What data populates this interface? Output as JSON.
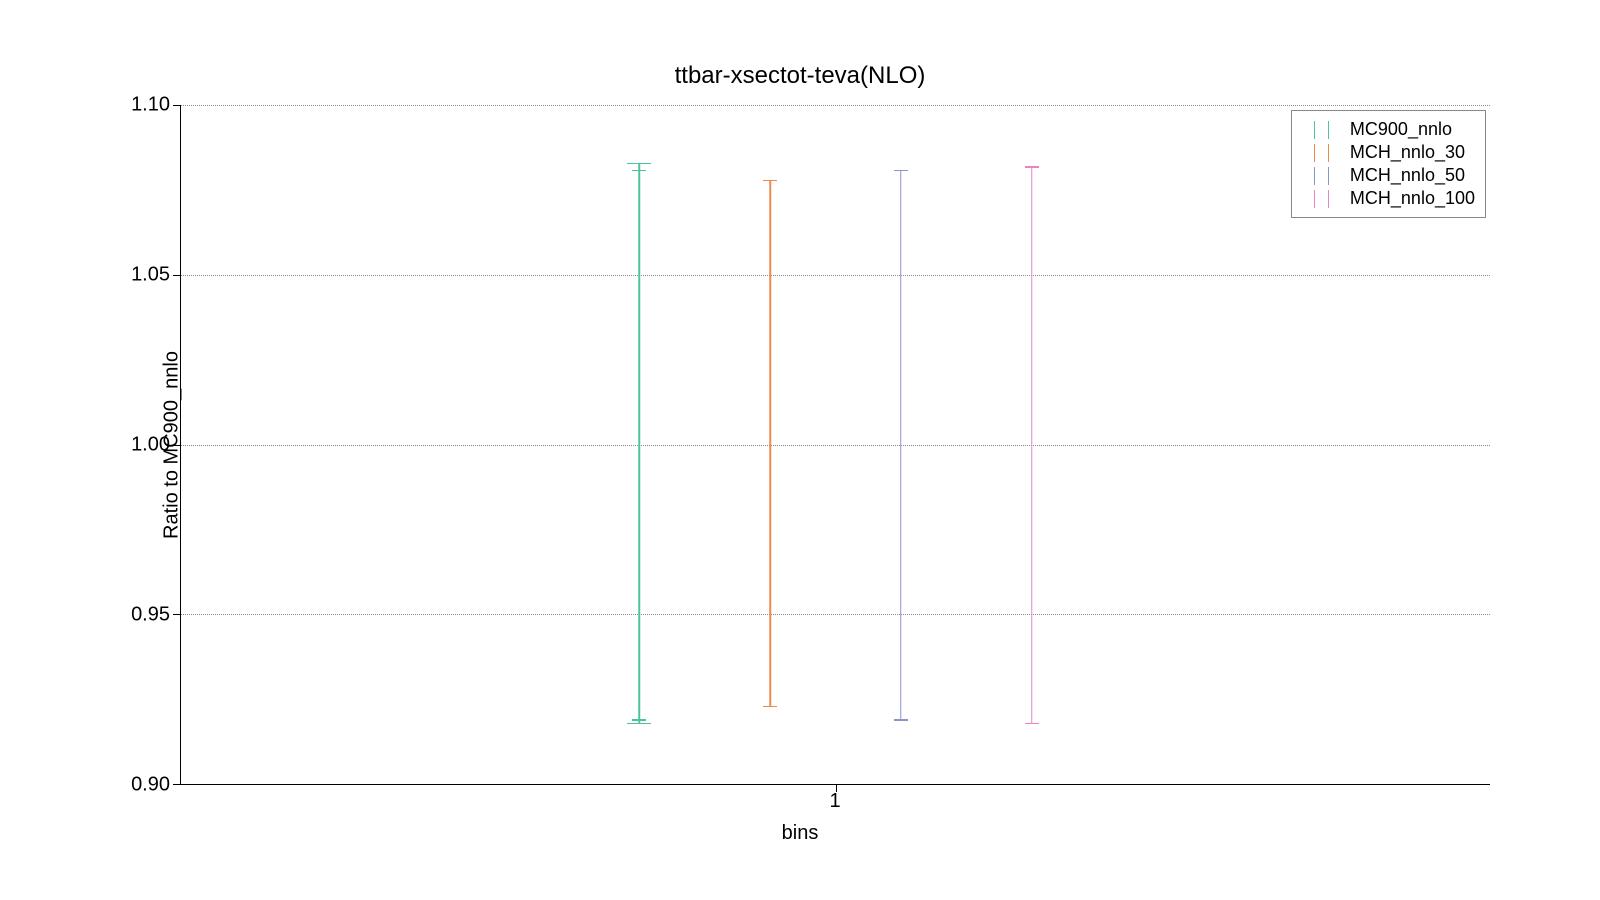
{
  "chart_data": {
    "type": "errorbar",
    "title": "ttbar-xsectot-teva(NLO)",
    "xlabel": "bins",
    "ylabel": "Ratio to MC900_nnlo",
    "ylim": [
      0.9,
      1.1
    ],
    "yticks": [
      "0.90",
      "0.95",
      "1.00",
      "1.05",
      "1.10"
    ],
    "xticks": [
      "1"
    ],
    "legend_position": "upper right",
    "grid": true,
    "series": [
      {
        "name": "MC900_nnlo",
        "color": "#4bc49a",
        "x_offset": -0.3,
        "center": 1.0,
        "inner_low": 0.919,
        "inner_high": 1.081,
        "outer_low": 0.918,
        "outer_high": 1.083
      },
      {
        "name": "MCH_nnlo_30",
        "color": "#f08a4b",
        "x_offset": -0.1,
        "center": 1.0,
        "inner_low": 0.923,
        "inner_high": 1.078,
        "outer_low": 0.923,
        "outer_high": 1.078
      },
      {
        "name": "MCH_nnlo_50",
        "color": "#8b94c9",
        "x_offset": 0.1,
        "center": 1.0,
        "inner_low": 0.919,
        "inner_high": 1.081,
        "outer_low": 0.919,
        "outer_high": 1.081
      },
      {
        "name": "MCH_nnlo_100",
        "color": "#e884c0",
        "x_offset": 0.3,
        "center": 1.0,
        "inner_low": 0.918,
        "inner_high": 1.082,
        "outer_low": 0.918,
        "outer_high": 1.082
      }
    ]
  }
}
